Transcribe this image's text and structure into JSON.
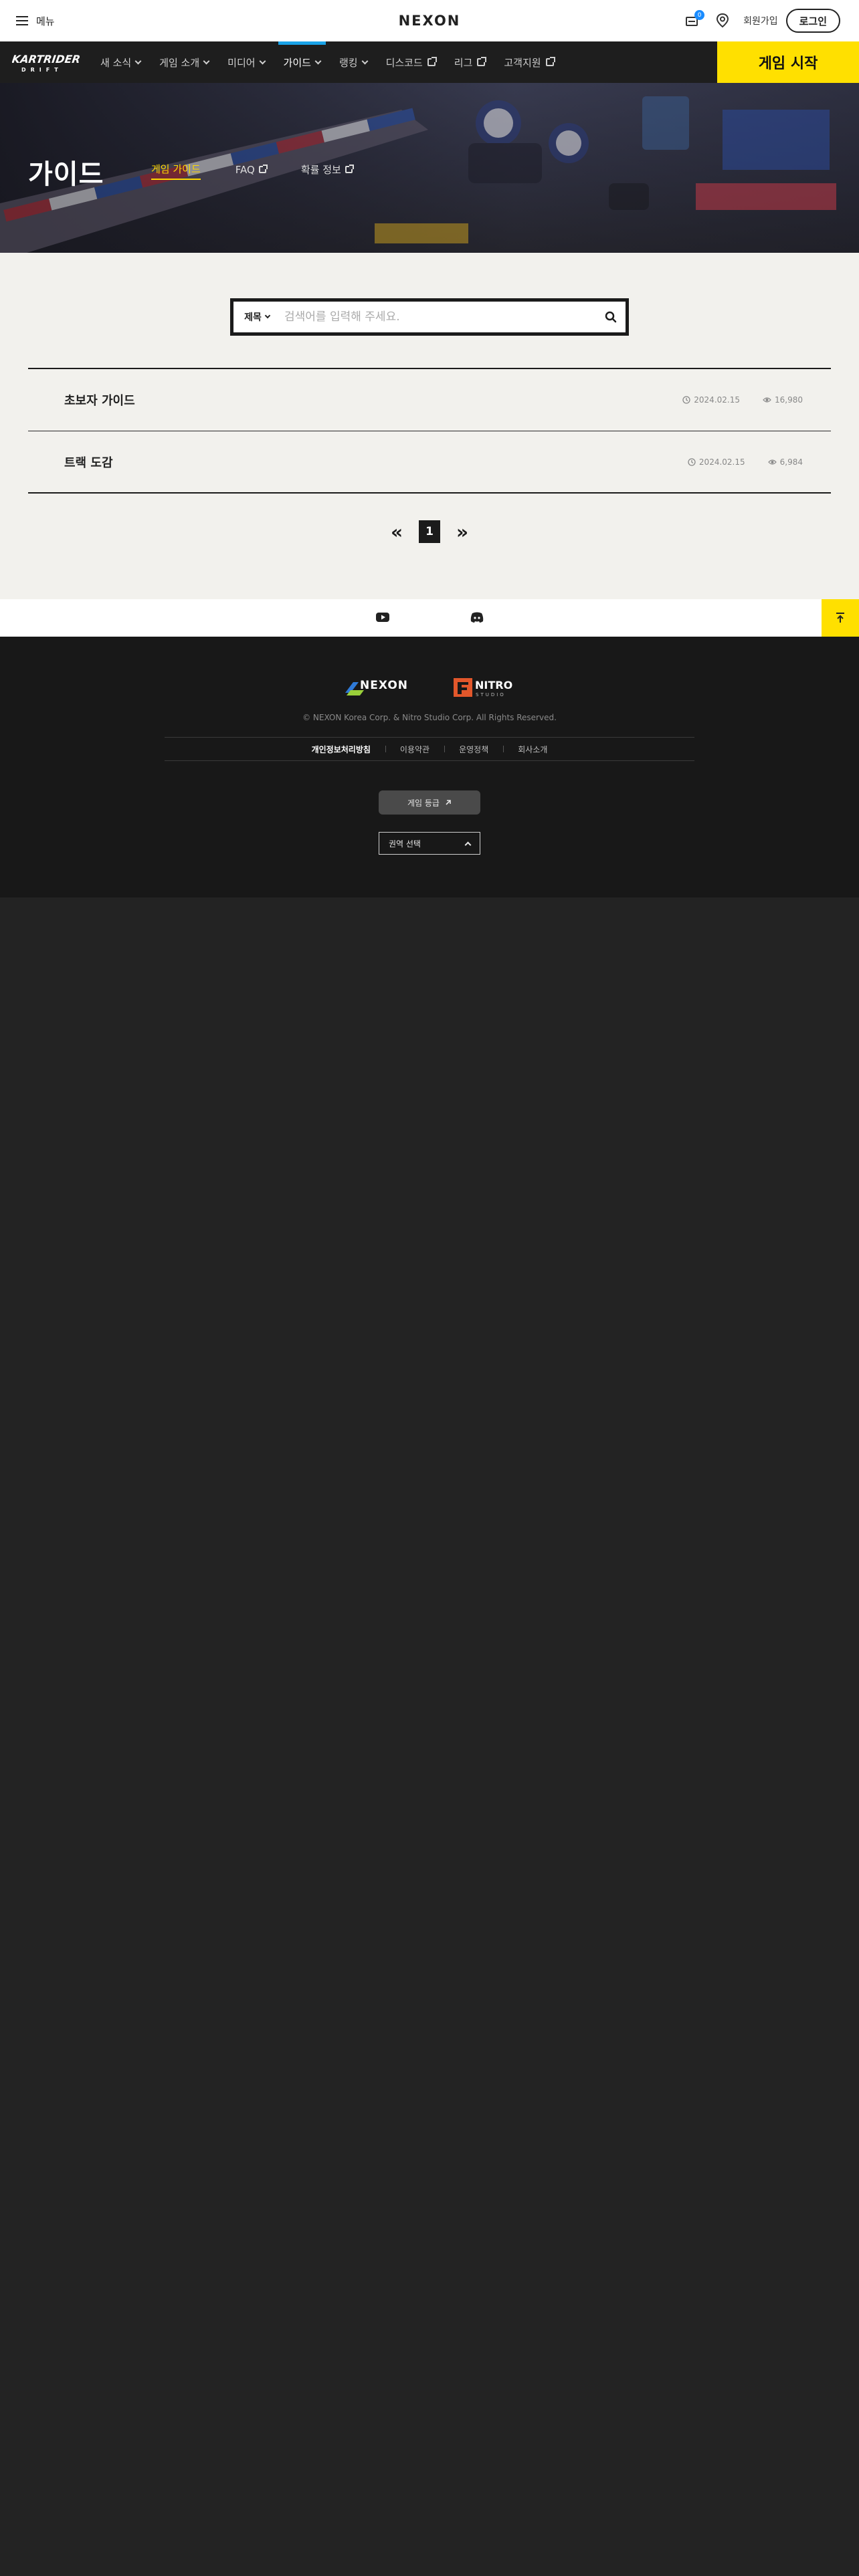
{
  "gnb": {
    "menu_label": "메뉴",
    "logo_text": "NEXON",
    "coupon_badge": "0",
    "join_label": "회원가입",
    "login_label": "로그인"
  },
  "gamenav": {
    "logo_text": "KARTRIDER",
    "logo_sub": "DRIFT",
    "items": [
      {
        "label": "새 소식",
        "type": "dropdown"
      },
      {
        "label": "게임 소개",
        "type": "dropdown"
      },
      {
        "label": "미디어",
        "type": "dropdown"
      },
      {
        "label": "가이드",
        "type": "dropdown"
      },
      {
        "label": "랭킹",
        "type": "dropdown"
      },
      {
        "label": "디스코드",
        "type": "external"
      },
      {
        "label": "리그",
        "type": "external"
      },
      {
        "label": "고객지원",
        "type": "external"
      }
    ],
    "active_index": 3,
    "start_label": "게임 시작",
    "accent_color": "#1aa3e8",
    "start_color": "#ffe000"
  },
  "hero": {
    "title": "가이드",
    "tabs": [
      {
        "label": "게임 가이드",
        "active": true
      },
      {
        "label": "FAQ",
        "external": true
      },
      {
        "label": "확률 정보",
        "external": true
      }
    ]
  },
  "search": {
    "select_value": "제목",
    "placeholder": "검색어를 입력해 주세요."
  },
  "posts": [
    {
      "title": "초보자 가이드",
      "date": "2024.02.15",
      "views": "16,980"
    },
    {
      "title": "트랙 도감",
      "date": "2024.02.15",
      "views": "6,984"
    }
  ],
  "pager": {
    "prev": "«",
    "current": "1",
    "next": "»"
  },
  "sns": {
    "icons": [
      "youtube-icon",
      "discord-icon",
      "scroll-top-icon"
    ]
  },
  "footer": {
    "nexon_logo": "NEXON",
    "nitro_logo": "NITRO",
    "nitro_sub": "STUDIO",
    "copyright": "© NEXON Korea Corp. & Nitro Studio Corp. All Rights Reserved.",
    "links": [
      {
        "label": "개인정보처리방침",
        "strong": true
      },
      {
        "label": "이용약관",
        "strong": false
      },
      {
        "label": "운영정책",
        "strong": false
      },
      {
        "label": "회사소개",
        "strong": false
      }
    ],
    "rating_label": "게임 등급",
    "region_label": "권역 선택"
  }
}
